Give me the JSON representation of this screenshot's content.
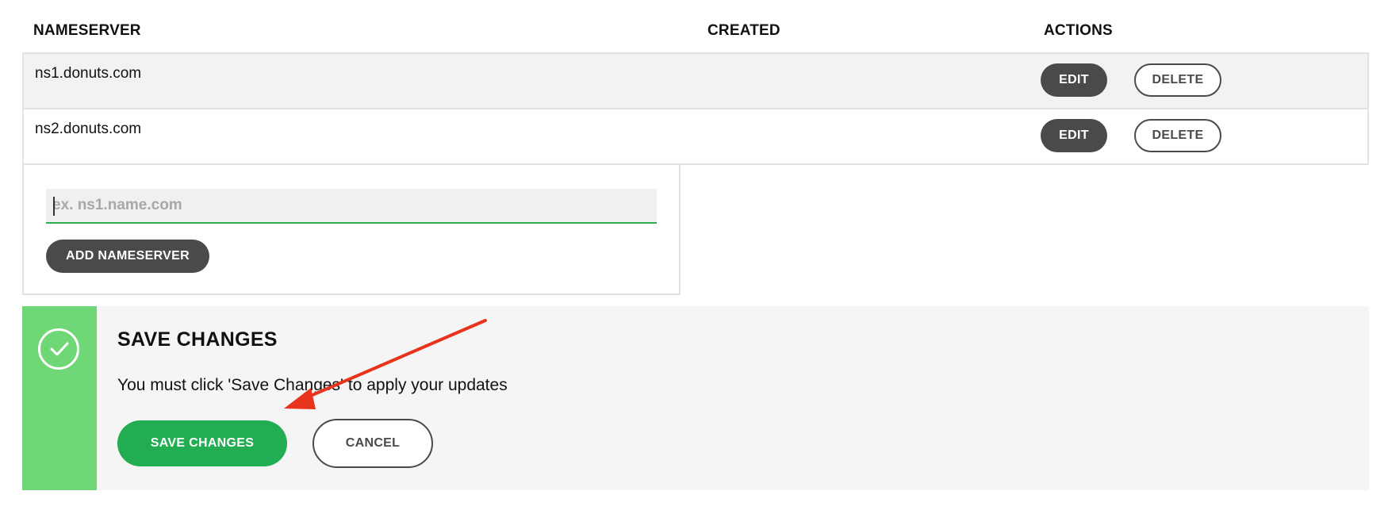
{
  "table": {
    "headers": {
      "nameserver": "NAMESERVER",
      "created": "CREATED",
      "actions": "ACTIONS"
    },
    "rows": [
      {
        "nameserver": "ns1.donuts.com",
        "created": "",
        "edit_label": "EDIT",
        "delete_label": "DELETE"
      },
      {
        "nameserver": "ns2.donuts.com",
        "created": "",
        "edit_label": "EDIT",
        "delete_label": "DELETE"
      }
    ]
  },
  "add_nameserver": {
    "input_value": "",
    "input_placeholder": "ex. ns1.name.com",
    "button_label": "ADD NAMESERVER"
  },
  "save_banner": {
    "title": "SAVE CHANGES",
    "message": "You must click 'Save Changes' to apply your updates",
    "save_label": "SAVE CHANGES",
    "cancel_label": "CANCEL",
    "icon": "check-circle-icon"
  },
  "annotation": {
    "arrow_color": "#e8341c",
    "icon": "arrow-annotation"
  },
  "colors": {
    "accent_green": "#22ad52",
    "strip_green": "#6fd775",
    "dark_button": "#4a4a4a",
    "row_shade": "#f2f2f2"
  }
}
